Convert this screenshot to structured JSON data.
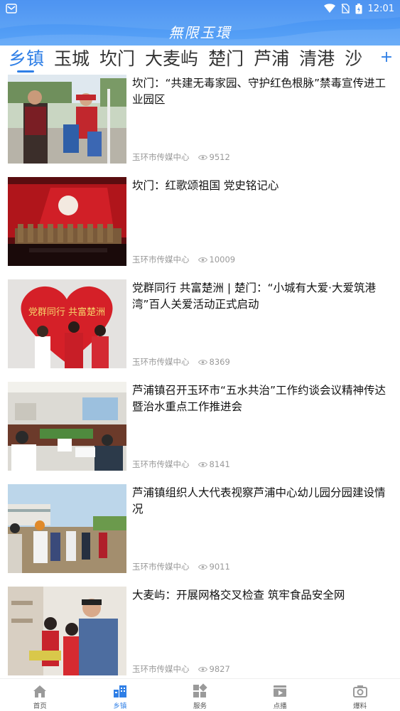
{
  "status_bar": {
    "time": "12:01"
  },
  "header": {
    "title": "無限玉環"
  },
  "tabs": [
    {
      "label": "乡镇",
      "active": true
    },
    {
      "label": "玉城",
      "active": false
    },
    {
      "label": "坎门",
      "active": false
    },
    {
      "label": "大麦屿",
      "active": false
    },
    {
      "label": "楚门",
      "active": false
    },
    {
      "label": "芦浦",
      "active": false
    },
    {
      "label": "清港",
      "active": false
    },
    {
      "label": "沙",
      "active": false
    }
  ],
  "tabs_add": "+",
  "articles": [
    {
      "title": "坎门：“共建无毒家园、守护红色根脉”禁毒宣传进工业园区",
      "source": "玉环市传媒中心",
      "views": "9512"
    },
    {
      "title": "坎门：红歌颂祖国 党史铭记心",
      "source": "玉环市传媒中心",
      "views": "10009"
    },
    {
      "title": "党群同行 共富楚洲 | 楚门：“小城有大爱·大爱筑港湾”百人关爱活动正式启动",
      "source": "玉环市传媒中心",
      "views": "8369",
      "image_text": "党群同行 共富楚洲"
    },
    {
      "title": "芦浦镇召开玉环市“五水共治”工作约谈会议精神传达暨治水重点工作推进会",
      "source": "玉环市传媒中心",
      "views": "8141"
    },
    {
      "title": "芦浦镇组织人大代表视察芦浦中心幼儿园分园建设情况",
      "source": "玉环市传媒中心",
      "views": "9011"
    },
    {
      "title": "大麦屿：开展网格交叉检查 筑牢食品安全网",
      "source": "玉环市传媒中心",
      "views": "9827"
    }
  ],
  "bottom_nav": [
    {
      "label": "首页",
      "icon": "home-icon",
      "active": false
    },
    {
      "label": "乡镇",
      "icon": "town-icon",
      "active": true
    },
    {
      "label": "服务",
      "icon": "grid-icon",
      "active": false
    },
    {
      "label": "点播",
      "icon": "video-icon",
      "active": false
    },
    {
      "label": "爆料",
      "icon": "camera-icon",
      "active": false
    }
  ],
  "colors": {
    "accent": "#2f7fe6",
    "header": "#4a96f3",
    "meta": "#999999"
  }
}
